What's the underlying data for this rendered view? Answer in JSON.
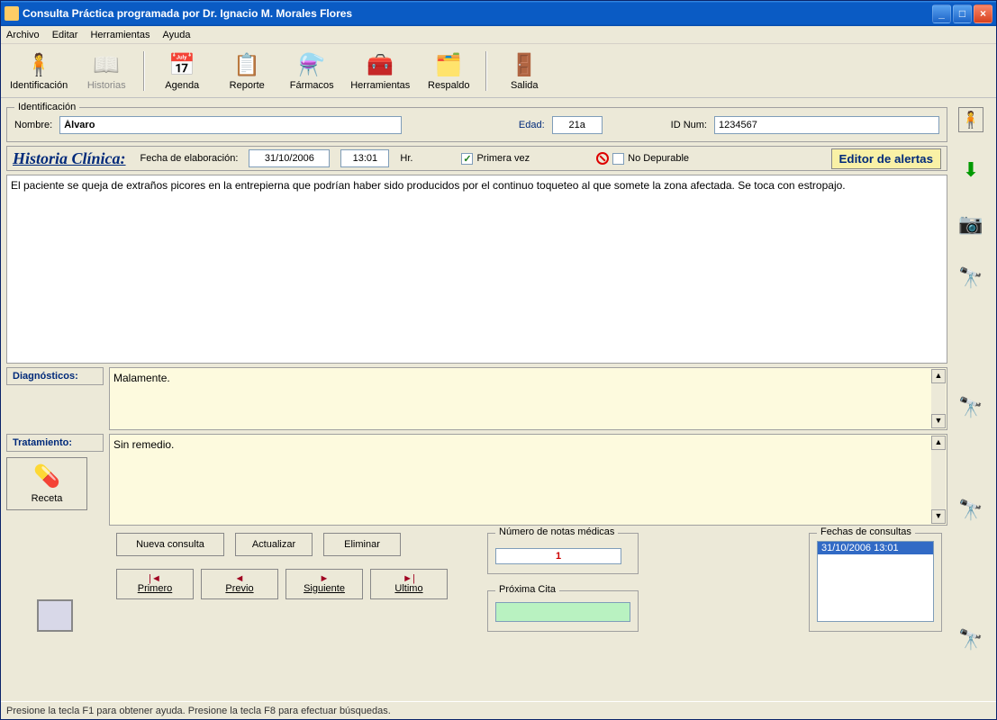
{
  "window": {
    "title": "Consulta Práctica programada por Dr. Ignacio M. Morales Flores"
  },
  "menu": {
    "archivo": "Archivo",
    "editar": "Editar",
    "herramientas": "Herramientas",
    "ayuda": "Ayuda"
  },
  "toolbar": {
    "identificacion": "Identificación",
    "historias": "Historias",
    "agenda": "Agenda",
    "reporte": "Reporte",
    "farmacos": "Fármacos",
    "herramientas": "Herramientas",
    "respaldo": "Respaldo",
    "salida": "Salida"
  },
  "ident": {
    "legend": "Identificación",
    "nombre_label": "Nombre:",
    "nombre_value": "Álvaro",
    "edad_label": "Edad:",
    "edad_value": "21a",
    "id_label": "ID Num:",
    "id_value": "1234567"
  },
  "historia": {
    "title": "Historia Clínica:",
    "fecha_label": "Fecha de elaboración:",
    "fecha_value": "31/10/2006",
    "hora_value": "13:01",
    "hora_suffix": "Hr.",
    "primera_vez_label": "Primera vez",
    "no_depurable_label": "No Depurable",
    "alertas_button": "Editor de alertas",
    "text": "El paciente se queja de extraños picores en la entrepierna que podrían haber sido producidos por el continuo toqueteo al que somete la zona afectada. Se toca con estropajo."
  },
  "diag": {
    "label": "Diagnósticos:",
    "text": "Malamente."
  },
  "trat": {
    "label": "Tratamiento:",
    "text": "Sin remedio.",
    "receta_button": "Receta"
  },
  "actions": {
    "nueva": "Nueva consulta",
    "actualizar": "Actualizar",
    "eliminar": "Eliminar",
    "primero": "Primero",
    "previo": "Previo",
    "siguiente": "Siguiente",
    "ultimo": "Ultimo"
  },
  "notes": {
    "legend": "Número de notas médicas",
    "count": "1"
  },
  "cita": {
    "legend": "Próxima Cita"
  },
  "fechas": {
    "legend": "Fechas de consultas",
    "selected": "31/10/2006 13:01"
  },
  "status": {
    "text": "Presione la tecla F1 para obtener ayuda. Presione la tecla F8 para efectuar búsquedas."
  }
}
